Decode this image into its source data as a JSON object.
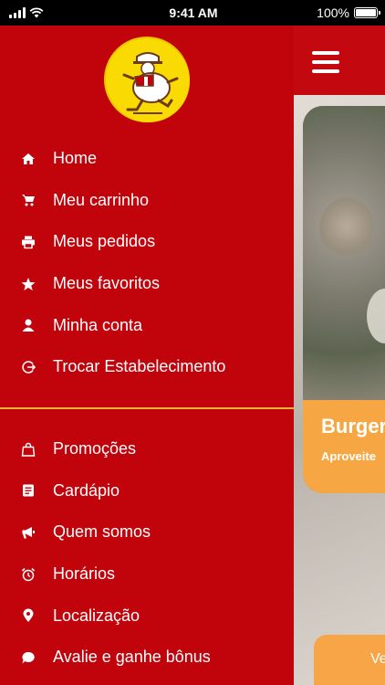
{
  "status_bar": {
    "time": "9:41 AM",
    "battery": "100%",
    "battery_level": 1.0
  },
  "brand": {
    "primary": "#c1040c",
    "accent": "#f2b232",
    "logo_bg": "#f9da02",
    "orange": "#f6a743"
  },
  "background_app": {
    "promo_title": "Burger",
    "promo_subtitle": "Aproveite",
    "bottom_button": "Ve"
  },
  "menu_primary": [
    {
      "label": "Home",
      "icon": "home-icon"
    },
    {
      "label": "Meu carrinho",
      "icon": "cart-icon"
    },
    {
      "label": "Meus pedidos",
      "icon": "printer-icon"
    },
    {
      "label": "Meus favoritos",
      "icon": "star-icon"
    },
    {
      "label": "Minha conta",
      "icon": "user-icon"
    },
    {
      "label": "Trocar Estabelecimento",
      "icon": "switch-icon"
    }
  ],
  "menu_secondary": [
    {
      "label": "Promoções",
      "icon": "shopping-bag-icon"
    },
    {
      "label": "Cardápio",
      "icon": "menu-card-icon"
    },
    {
      "label": "Quem somos",
      "icon": "megaphone-icon"
    },
    {
      "label": "Horários",
      "icon": "alarm-clock-icon"
    },
    {
      "label": "Localização",
      "icon": "location-pin-icon"
    },
    {
      "label": "Avalie e ganhe bônus",
      "icon": "chat-bubble-icon"
    }
  ]
}
